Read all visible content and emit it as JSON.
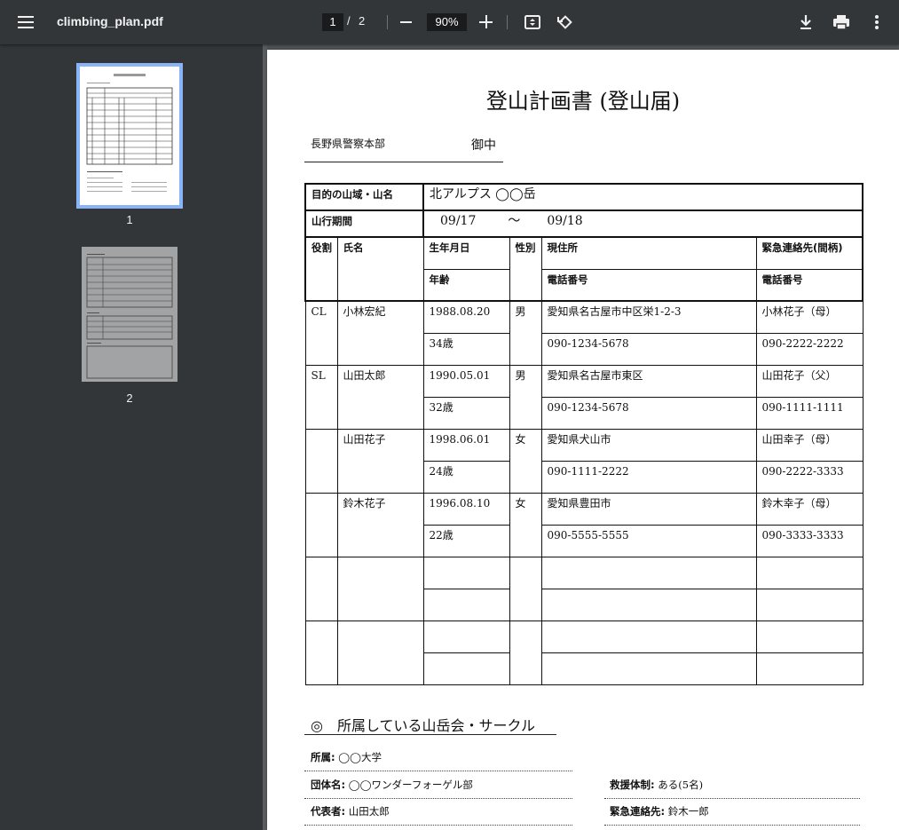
{
  "toolbar": {
    "title": "climbing_plan.pdf",
    "current_page": "1",
    "separator": "/",
    "total_pages": "2",
    "zoom": "90%"
  },
  "sidebar": {
    "thumbnails": [
      {
        "label": "1",
        "selected": true
      },
      {
        "label": "2",
        "selected": false
      }
    ]
  },
  "document": {
    "title": "登山計画書 (登山届)",
    "addressee": "長野県警察本部",
    "honorific": "御中",
    "target_label": "目的の山域・山名",
    "target_value": "北アルプス ◯◯岳",
    "period_label": "山行期間",
    "period_start": "09/17",
    "period_tilde": "〜",
    "period_end": "09/18",
    "headers": {
      "role": "役割",
      "name": "氏名",
      "birthdate": "生年月日",
      "age": "年齢",
      "gender": "性別",
      "address": "現住所",
      "phone": "電話番号",
      "emergency": "緊急連絡先(間柄)",
      "emergency_phone": "電話番号"
    },
    "members": [
      {
        "role": "CL",
        "name": "小林宏紀",
        "birthdate": "1988.08.20",
        "age": "34歳",
        "gender": "男",
        "address": "愛知県名古屋市中区栄1-2-3",
        "phone": "090-1234-5678",
        "emergency": "小林花子（母）",
        "emergency_phone": "090-2222-2222"
      },
      {
        "role": "SL",
        "name": "山田太郎",
        "birthdate": "1990.05.01",
        "age": "32歳",
        "gender": "男",
        "address": "愛知県名古屋市東区",
        "phone": "090-1234-5678",
        "emergency": "山田花子（父）",
        "emergency_phone": "090-1111-1111"
      },
      {
        "role": "",
        "name": "山田花子",
        "birthdate": "1998.06.01",
        "age": "24歳",
        "gender": "女",
        "address": "愛知県犬山市",
        "phone": "090-1111-2222",
        "emergency": "山田幸子（母）",
        "emergency_phone": "090-2222-3333"
      },
      {
        "role": "",
        "name": "鈴木花子",
        "birthdate": "1996.08.10",
        "age": "22歳",
        "gender": "女",
        "address": "愛知県豊田市",
        "phone": "090-5555-5555",
        "emergency": "鈴木幸子（母）",
        "emergency_phone": "090-3333-3333"
      },
      {
        "role": "",
        "name": "",
        "birthdate": "",
        "age": "",
        "gender": "",
        "address": "",
        "phone": "",
        "emergency": "",
        "emergency_phone": ""
      },
      {
        "role": "",
        "name": "",
        "birthdate": "",
        "age": "",
        "gender": "",
        "address": "",
        "phone": "",
        "emergency": "",
        "emergency_phone": ""
      }
    ],
    "club_section_title": "◎　所属している山岳会・サークル",
    "affiliation_label": "所属:",
    "affiliation_value": "◯◯大学",
    "group_label": "団体名:",
    "group_value": "◯◯ワンダーフォーゲル部",
    "rescue_label": "救援体制:",
    "rescue_value": "ある(5名)",
    "representative_label": "代表者:",
    "representative_value": "山田太郎",
    "emergency_contact_label": "緊急連絡先:",
    "emergency_contact_value": "鈴木一郎"
  }
}
